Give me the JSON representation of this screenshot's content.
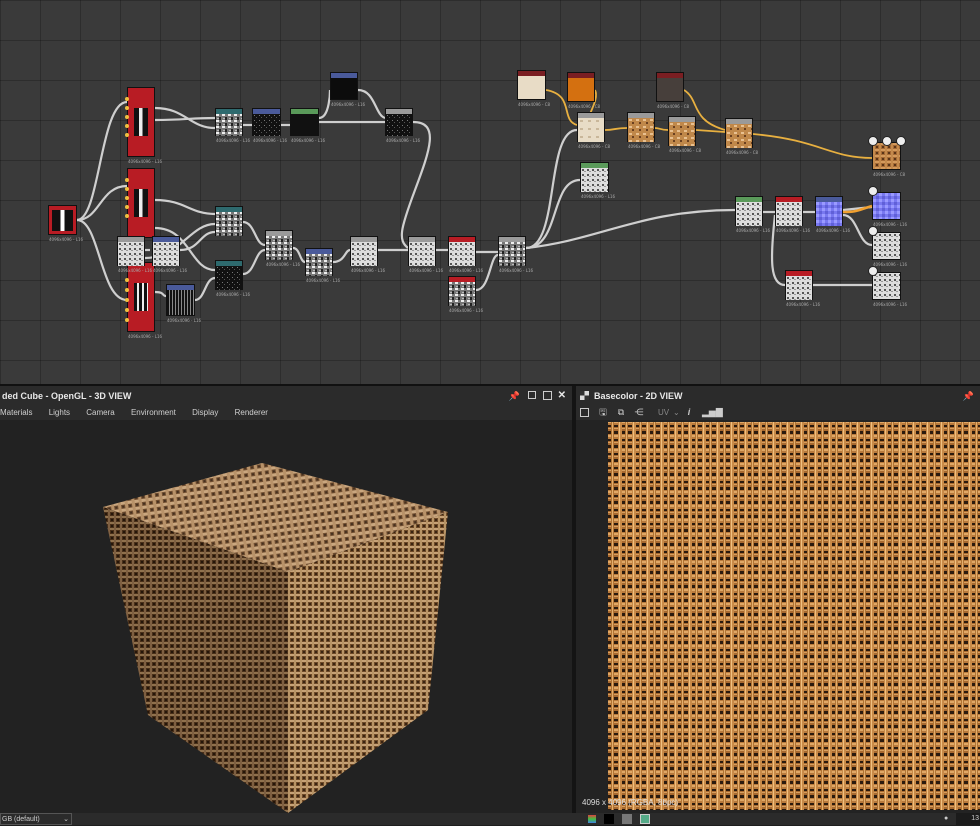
{
  "graph": {
    "labels": {
      "gray": "4096x4096 - L16",
      "color": "4096x4096 - C8"
    }
  },
  "view3d": {
    "title": "ded Cube - OpenGL - 3D VIEW",
    "menu": [
      "Materials",
      "Lights",
      "Camera",
      "Environment",
      "Display",
      "Renderer"
    ]
  },
  "view2d": {
    "title": "Basecolor - 2D VIEW",
    "uv_label": "UV",
    "info": "4096 x 4096 (RGBA, 8bpc)"
  },
  "status": {
    "colorspace": "GB (default)",
    "zoom_value": "13"
  },
  "icons": {
    "pin": "pin-icon",
    "maximize": "maximize-icon",
    "close": "close-icon",
    "checker": "checkerboard-icon"
  },
  "colors": {
    "node_red": "#b81c24",
    "node_teal": "#2e6a6e",
    "node_blue": "#4a5a9a",
    "node_green": "#5a9a5a",
    "node_gray": "#9a9a9a",
    "node_darkred": "#7a1e22",
    "wire_gray": "#cfcfcf",
    "wire_yellow": "#e8b040",
    "burlap": "#b07438"
  }
}
